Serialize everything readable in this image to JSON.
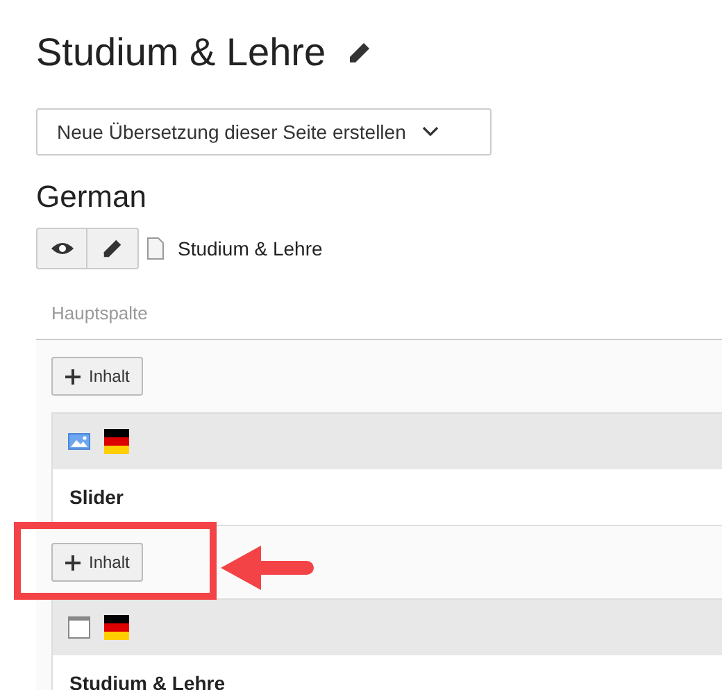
{
  "page_title": "Studium & Lehre",
  "translation_select": {
    "value": "Neue Übersetzung dieser Seite erstellen"
  },
  "language": {
    "title": "German",
    "page_name": "Studium & Lehre"
  },
  "column": {
    "title": "Hauptspalte",
    "elements": [
      {
        "kind": "add",
        "label": "Inhalt",
        "highlighted": false
      },
      {
        "kind": "image",
        "title": "Slider"
      },
      {
        "kind": "add",
        "label": "Inhalt",
        "highlighted": true
      },
      {
        "kind": "text",
        "title": "Studium & Lehre"
      }
    ]
  }
}
